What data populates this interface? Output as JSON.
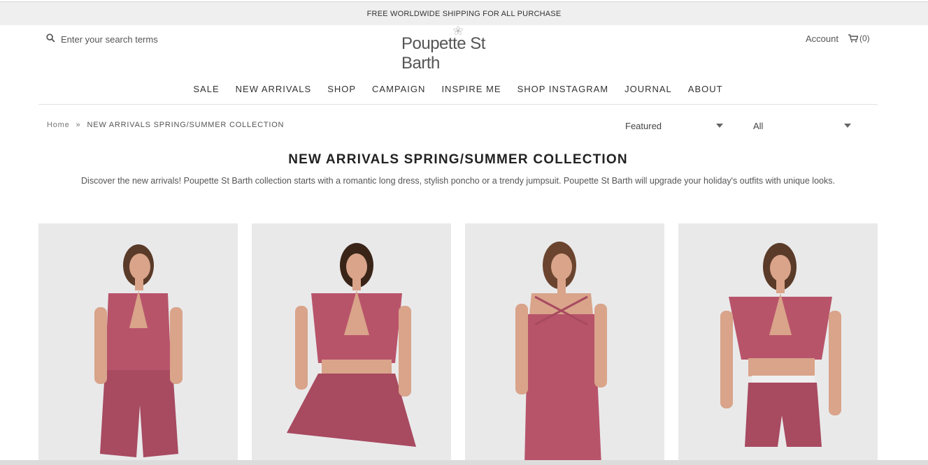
{
  "promo": {
    "text": "FREE WORLDWIDE SHIPPING FOR ALL PURCHASE"
  },
  "header": {
    "search_placeholder": "Enter your search terms",
    "logo_text": "Poupette St Barth",
    "account_label": "Account",
    "cart_label": "(0)"
  },
  "nav": {
    "items": [
      "SALE",
      "NEW ARRIVALS",
      "SHOP",
      "CAMPAIGN",
      "INSPIRE ME",
      "SHOP INSTAGRAM",
      "JOURNAL",
      "ABOUT"
    ]
  },
  "breadcrumb": {
    "home": "Home",
    "separator": "»",
    "current": "NEW ARRIVALS SPRING/SUMMER COLLECTION"
  },
  "sort": {
    "selected": "Featured"
  },
  "filter": {
    "selected": "All"
  },
  "collection": {
    "title": "NEW ARRIVALS SPRING/SUMMER COLLECTION",
    "description": "Discover the new arrivals! Poupette St Barth collection starts with a romantic long dress, stylish poncho or a trendy jumpsuit. Poupette St Barth will upgrade your holiday's outfits with unique looks."
  },
  "colors": {
    "garment": "#b8546a",
    "skin": "#d9a48a",
    "hair": "#5a3a28",
    "background": "#eaeaea"
  }
}
